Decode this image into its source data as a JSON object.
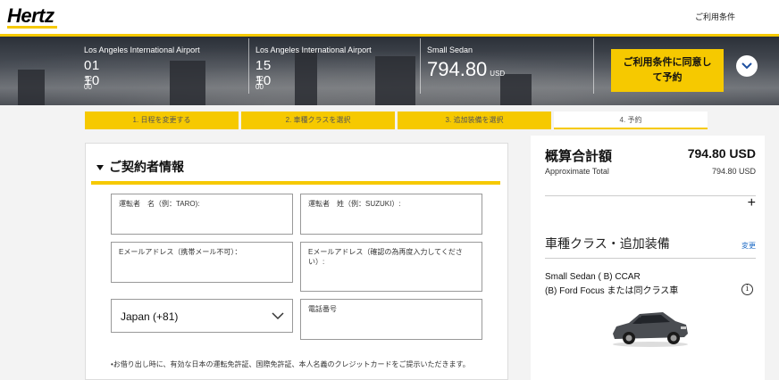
{
  "header": {
    "logo": "Hertz",
    "terms_link": "ご利用条件"
  },
  "trip": {
    "pickup": {
      "location": "Los Angeles International Airport",
      "date": "01 10",
      "time": "12 00"
    },
    "dropoff": {
      "location": "Los Angeles International Airport",
      "date": "15 10",
      "time": "12 00"
    },
    "vehicle": {
      "name": "Small Sedan",
      "price": "794.80",
      "currency": "USD"
    },
    "agree_button": {
      "line1": "ご利用条件に同意し",
      "line2": "て予約"
    }
  },
  "steps": [
    {
      "label": "1.  日程を変更する"
    },
    {
      "label": "2.  車種クラスを選択"
    },
    {
      "label": "3.  追加装備を選択"
    },
    {
      "label": "4.  予約"
    }
  ],
  "form": {
    "section_title": "ご契約者情報",
    "first_name_placeholder": "運転者　名（例：TARO):",
    "last_name_placeholder": "運転者　姓（例：SUZUKI）:",
    "email_placeholder": "Eメールアドレス（携帯メール不可）：",
    "email_confirm_placeholder": "Eメールアドレス（確認の為再度入力してください）:",
    "country_code": "Japan (+81)",
    "phone_placeholder": "電話番号",
    "note": "•お借り出し時に、有効な日本の運転免許証、国際免許証、本人名義のクレジットカードをご提示いただきます。"
  },
  "summary": {
    "title": "概算合計額",
    "total": "794.80 USD",
    "approx_label": "Approximate Total",
    "approx_value": "794.80 USD",
    "expand_symbol": "+",
    "section2_title": "車種クラス・追加装備",
    "change_link": "変更",
    "car_class": "Small Sedan ( B) CCAR",
    "car_model": "(B) Ford Focus または同クラス車",
    "car_color": "#4a4d52"
  }
}
